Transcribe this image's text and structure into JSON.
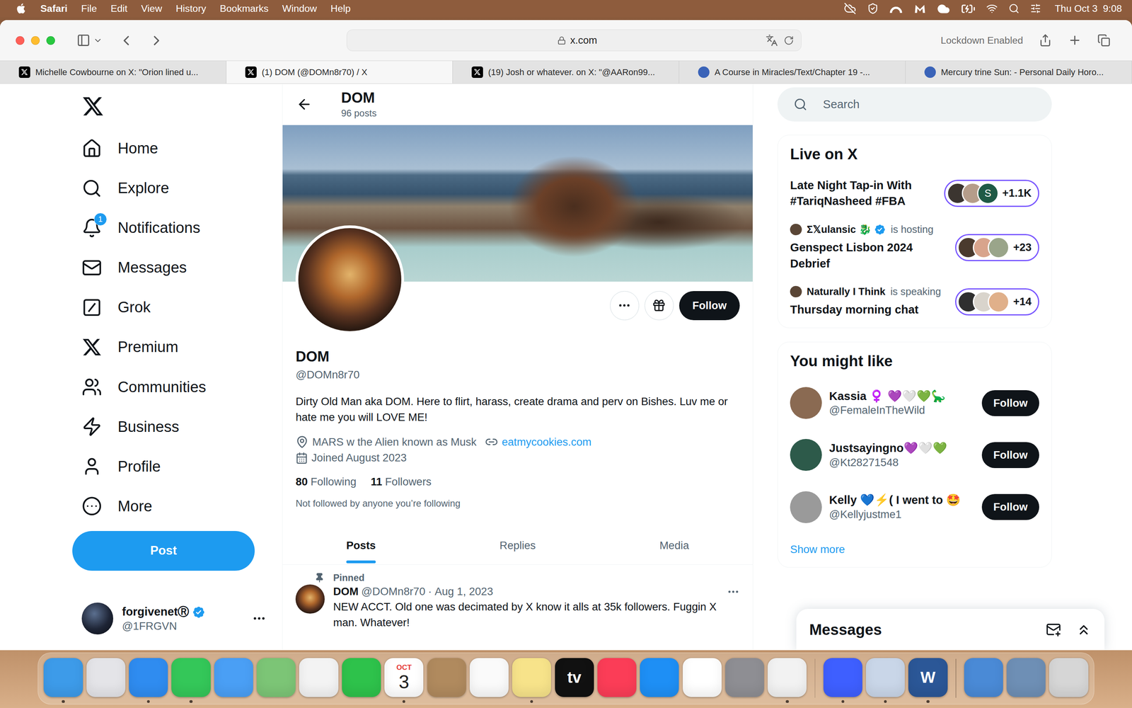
{
  "menu_bar": {
    "app": "Safari",
    "menus": [
      "File",
      "Edit",
      "View",
      "History",
      "Bookmarks",
      "Window",
      "Help"
    ],
    "clock": "Thu Oct 3  9:08"
  },
  "toolbar": {
    "url": "x.com",
    "lockdown": "Lockdown Enabled"
  },
  "tabs": [
    {
      "label": "Michelle Cowbourne on X: \"Orion lined u...",
      "selected": false,
      "kind": "x"
    },
    {
      "label": "(1) DOM (@DOMn8r70) / X",
      "selected": true,
      "kind": "x"
    },
    {
      "label": "(19) Josh or whatever. on X: \"@AARon99...",
      "selected": false,
      "kind": "x"
    },
    {
      "label": "A Course in Miracles/Text/Chapter 19 -...",
      "selected": false,
      "kind": "web"
    },
    {
      "label": "Mercury trine Sun: - Personal Daily Horo...",
      "selected": false,
      "kind": "web"
    }
  ],
  "nav": {
    "items": [
      {
        "label": "Home",
        "badge": ""
      },
      {
        "label": "Explore",
        "badge": ""
      },
      {
        "label": "Notifications",
        "badge": "1"
      },
      {
        "label": "Messages",
        "badge": ""
      },
      {
        "label": "Grok",
        "badge": ""
      },
      {
        "label": "Premium",
        "badge": ""
      },
      {
        "label": "Communities",
        "badge": ""
      },
      {
        "label": "Business",
        "badge": ""
      },
      {
        "label": "Profile",
        "badge": ""
      },
      {
        "label": "More",
        "badge": ""
      }
    ],
    "post": "Post",
    "account": {
      "name": "forgivenetⓇ",
      "handle": "@1FRGVN",
      "verified": true
    }
  },
  "profile": {
    "header_name": "DOM",
    "post_count": "96 posts",
    "name": "DOM",
    "handle": "@DOMn8r70",
    "follow": "Follow",
    "bio": "Dirty Old Man aka DOM. Here to flirt, harass, create drama and perv on Bishes. Luv me or hate me you will LOVE ME!",
    "location": "MARS w the Alien known as Musk",
    "link": "eatmycookies.com",
    "joined": "Joined August 2023",
    "following": {
      "count": "80",
      "label": "Following"
    },
    "followers": {
      "count": "11",
      "label": "Followers"
    },
    "followed_by": "Not followed by anyone you’re following"
  },
  "profile_tabs": [
    {
      "label": "Posts",
      "selected": true
    },
    {
      "label": "Replies",
      "selected": false
    },
    {
      "label": "Media",
      "selected": false
    }
  ],
  "pinned_post": {
    "label": "Pinned",
    "name": "DOM",
    "handle": "@DOMn8r70",
    "separator": "·",
    "date": "Aug 1, 2023",
    "text": "NEW ACCT. Old one was decimated by X know it alls at 35k followers. Fuggin X man. Whatever!"
  },
  "search": {
    "placeholder": "Search"
  },
  "live": {
    "title": "Live on X",
    "items": [
      {
        "host": "",
        "host_verified": false,
        "status": "",
        "title": "Late Night Tap-in With #TariqNasheed #FBA",
        "count": "+1.1K",
        "avatars": [
          {
            "letter": "",
            "color": "#3b3530"
          },
          {
            "letter": "",
            "color": "#b59d8a"
          },
          {
            "letter": "S",
            "color": "#1f5a46"
          }
        ]
      },
      {
        "host": "Σ𝕏ulansic 🐉",
        "host_verified": true,
        "status": "is hosting",
        "title": "Genspect Lisbon 2024 Debrief",
        "count": "+23",
        "avatars": [
          {
            "letter": "",
            "color": "#4a3a2e"
          },
          {
            "letter": "",
            "color": "#d8a48c"
          },
          {
            "letter": "",
            "color": "#9aa58a"
          }
        ]
      },
      {
        "host": "Naturally I Think",
        "host_verified": false,
        "status": "is speaking",
        "title": "Thursday morning chat",
        "count": "+14",
        "avatars": [
          {
            "letter": "",
            "color": "#2f2f2f"
          },
          {
            "letter": "",
            "color": "#d9d4cc"
          },
          {
            "letter": "",
            "color": "#e0b08a"
          }
        ]
      }
    ]
  },
  "suggestions": {
    "title": "You might like",
    "more": "Show more",
    "users": [
      {
        "name": "Kassia ♀️ 💜🤍💚🦕",
        "handle": "@FemaleInTheWild",
        "button": "Follow",
        "color": "#8a6a52"
      },
      {
        "name": "Justsayingno💜🤍💚",
        "handle": "@Kt28271548",
        "button": "Follow",
        "color": "#2d5a4a"
      },
      {
        "name": "Kelly 💙⚡( I went to 🤩",
        "handle": "@Kellyjustme1",
        "button": "Follow",
        "color": "#9a9a9a"
      }
    ]
  },
  "messages_drawer": {
    "title": "Messages"
  },
  "dock": [
    {
      "kind": "app",
      "color": "#3d9be9",
      "running": true
    },
    {
      "kind": "app",
      "color": "#e4e4e8",
      "running": false
    },
    {
      "kind": "app",
      "color": "#2f8cf0",
      "running": true
    },
    {
      "kind": "app",
      "color": "#34c759",
      "running": true
    },
    {
      "kind": "app",
      "color": "#4a9ff5",
      "running": false
    },
    {
      "kind": "app",
      "color": "#7cc576",
      "running": false
    },
    {
      "kind": "app",
      "color": "#f3f3f3",
      "running": false
    },
    {
      "kind": "app",
      "color": "#2ec24b",
      "running": false
    },
    {
      "kind": "calendar",
      "month": "OCT",
      "day": "3",
      "color": "#ffffff",
      "running": true
    },
    {
      "kind": "app",
      "color": "#b08a5e",
      "running": false
    },
    {
      "kind": "app",
      "color": "#fafafa",
      "running": false
    },
    {
      "kind": "app",
      "color": "#f7e38a",
      "running": true
    },
    {
      "kind": "label",
      "glyph": "tv",
      "color": "#111111",
      "running": false
    },
    {
      "kind": "app",
      "color": "#fb3d57",
      "running": false
    },
    {
      "kind": "app",
      "color": "#1e8ff5",
      "running": false
    },
    {
      "kind": "app",
      "color": "#ffffff",
      "running": false
    },
    {
      "kind": "app",
      "color": "#8e8e93",
      "running": false
    },
    {
      "kind": "app",
      "color": "#f2f2f2",
      "running": true
    },
    {
      "kind": "divider"
    },
    {
      "kind": "app",
      "color": "#3e5fff",
      "running": true
    },
    {
      "kind": "app",
      "color": "#c9d6e8",
      "running": true
    },
    {
      "kind": "label",
      "glyph": "W",
      "color": "#2b5797",
      "running": true
    },
    {
      "kind": "divider"
    },
    {
      "kind": "app",
      "color": "#4a8ad6",
      "running": false
    },
    {
      "kind": "app",
      "color": "#6e8fb5",
      "running": false
    },
    {
      "kind": "app",
      "color": "#d6d6d6",
      "running": false
    }
  ]
}
